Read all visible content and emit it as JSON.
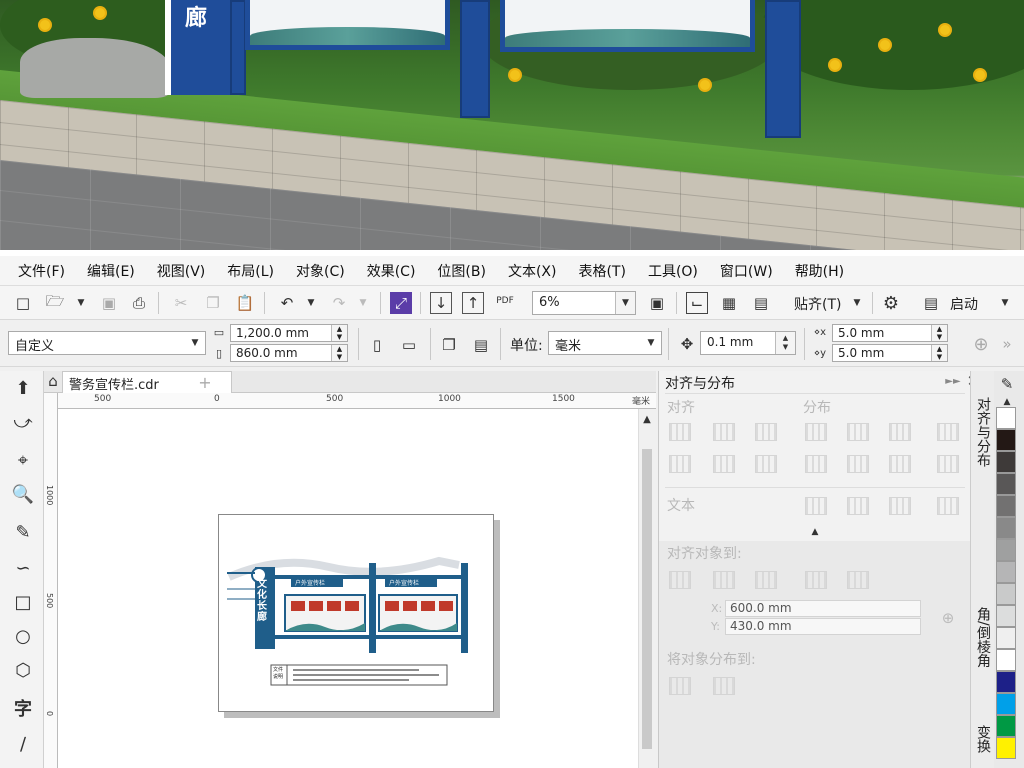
{
  "photo": {
    "sign_text": "廊"
  },
  "menu": [
    "文件(F)",
    "编辑(E)",
    "视图(V)",
    "布局(L)",
    "对象(C)",
    "效果(C)",
    "位图(B)",
    "文本(X)",
    "表格(T)",
    "工具(O)",
    "窗口(W)",
    "帮助(H)"
  ],
  "toolbar1": {
    "pdf_label": "PDF",
    "zoom_value": "6%",
    "snap_label": "贴齐(T)",
    "launch_label": "启动"
  },
  "toolbar2": {
    "page_size": "自定义",
    "width_value": "1,200.0 mm",
    "height_value": "860.0 mm",
    "units_label": "单位:",
    "units_value": "毫米",
    "nudge_value": "0.1 mm",
    "dup_x": "5.0 mm",
    "dup_y": "5.0 mm"
  },
  "document": {
    "tab_name": "警务宣传栏.cdr",
    "ruler_labels": [
      "500",
      "0",
      "500",
      "1000",
      "1500",
      "毫米"
    ],
    "vruler_labels": [
      "1000",
      "500",
      "0"
    ],
    "board_title": "文化长廊",
    "board_header_left": "户外宣传栏",
    "board_header_right": "户外宣传栏",
    "note_label": "文件说明"
  },
  "docker": {
    "title": "对齐与分布",
    "align_label": "对齐",
    "distribute_label": "分布",
    "text_label": "文本",
    "align_to_label": "对齐对象到:",
    "x_value": "600.0 mm",
    "y_value": "430.0 mm",
    "distribute_to_label": "将对象分布到:"
  },
  "sidetabs": {
    "tab1": "对齐与分布",
    "tab2": "角/倒棱角",
    "tab3": "变换"
  },
  "colors": {
    "accent_blue": "#1f4d9a",
    "board_blue": "#1f5e8a",
    "palette": [
      "#ffffff",
      "#231815",
      "#3e3a39",
      "#595757",
      "#727171",
      "#898989",
      "#9fa0a0",
      "#b5b5b6",
      "#c9caca",
      "#dcdddd",
      "#efefef",
      "#ffffff",
      "#1d2088",
      "#00a0e9",
      "#009944",
      "#fff100"
    ]
  }
}
